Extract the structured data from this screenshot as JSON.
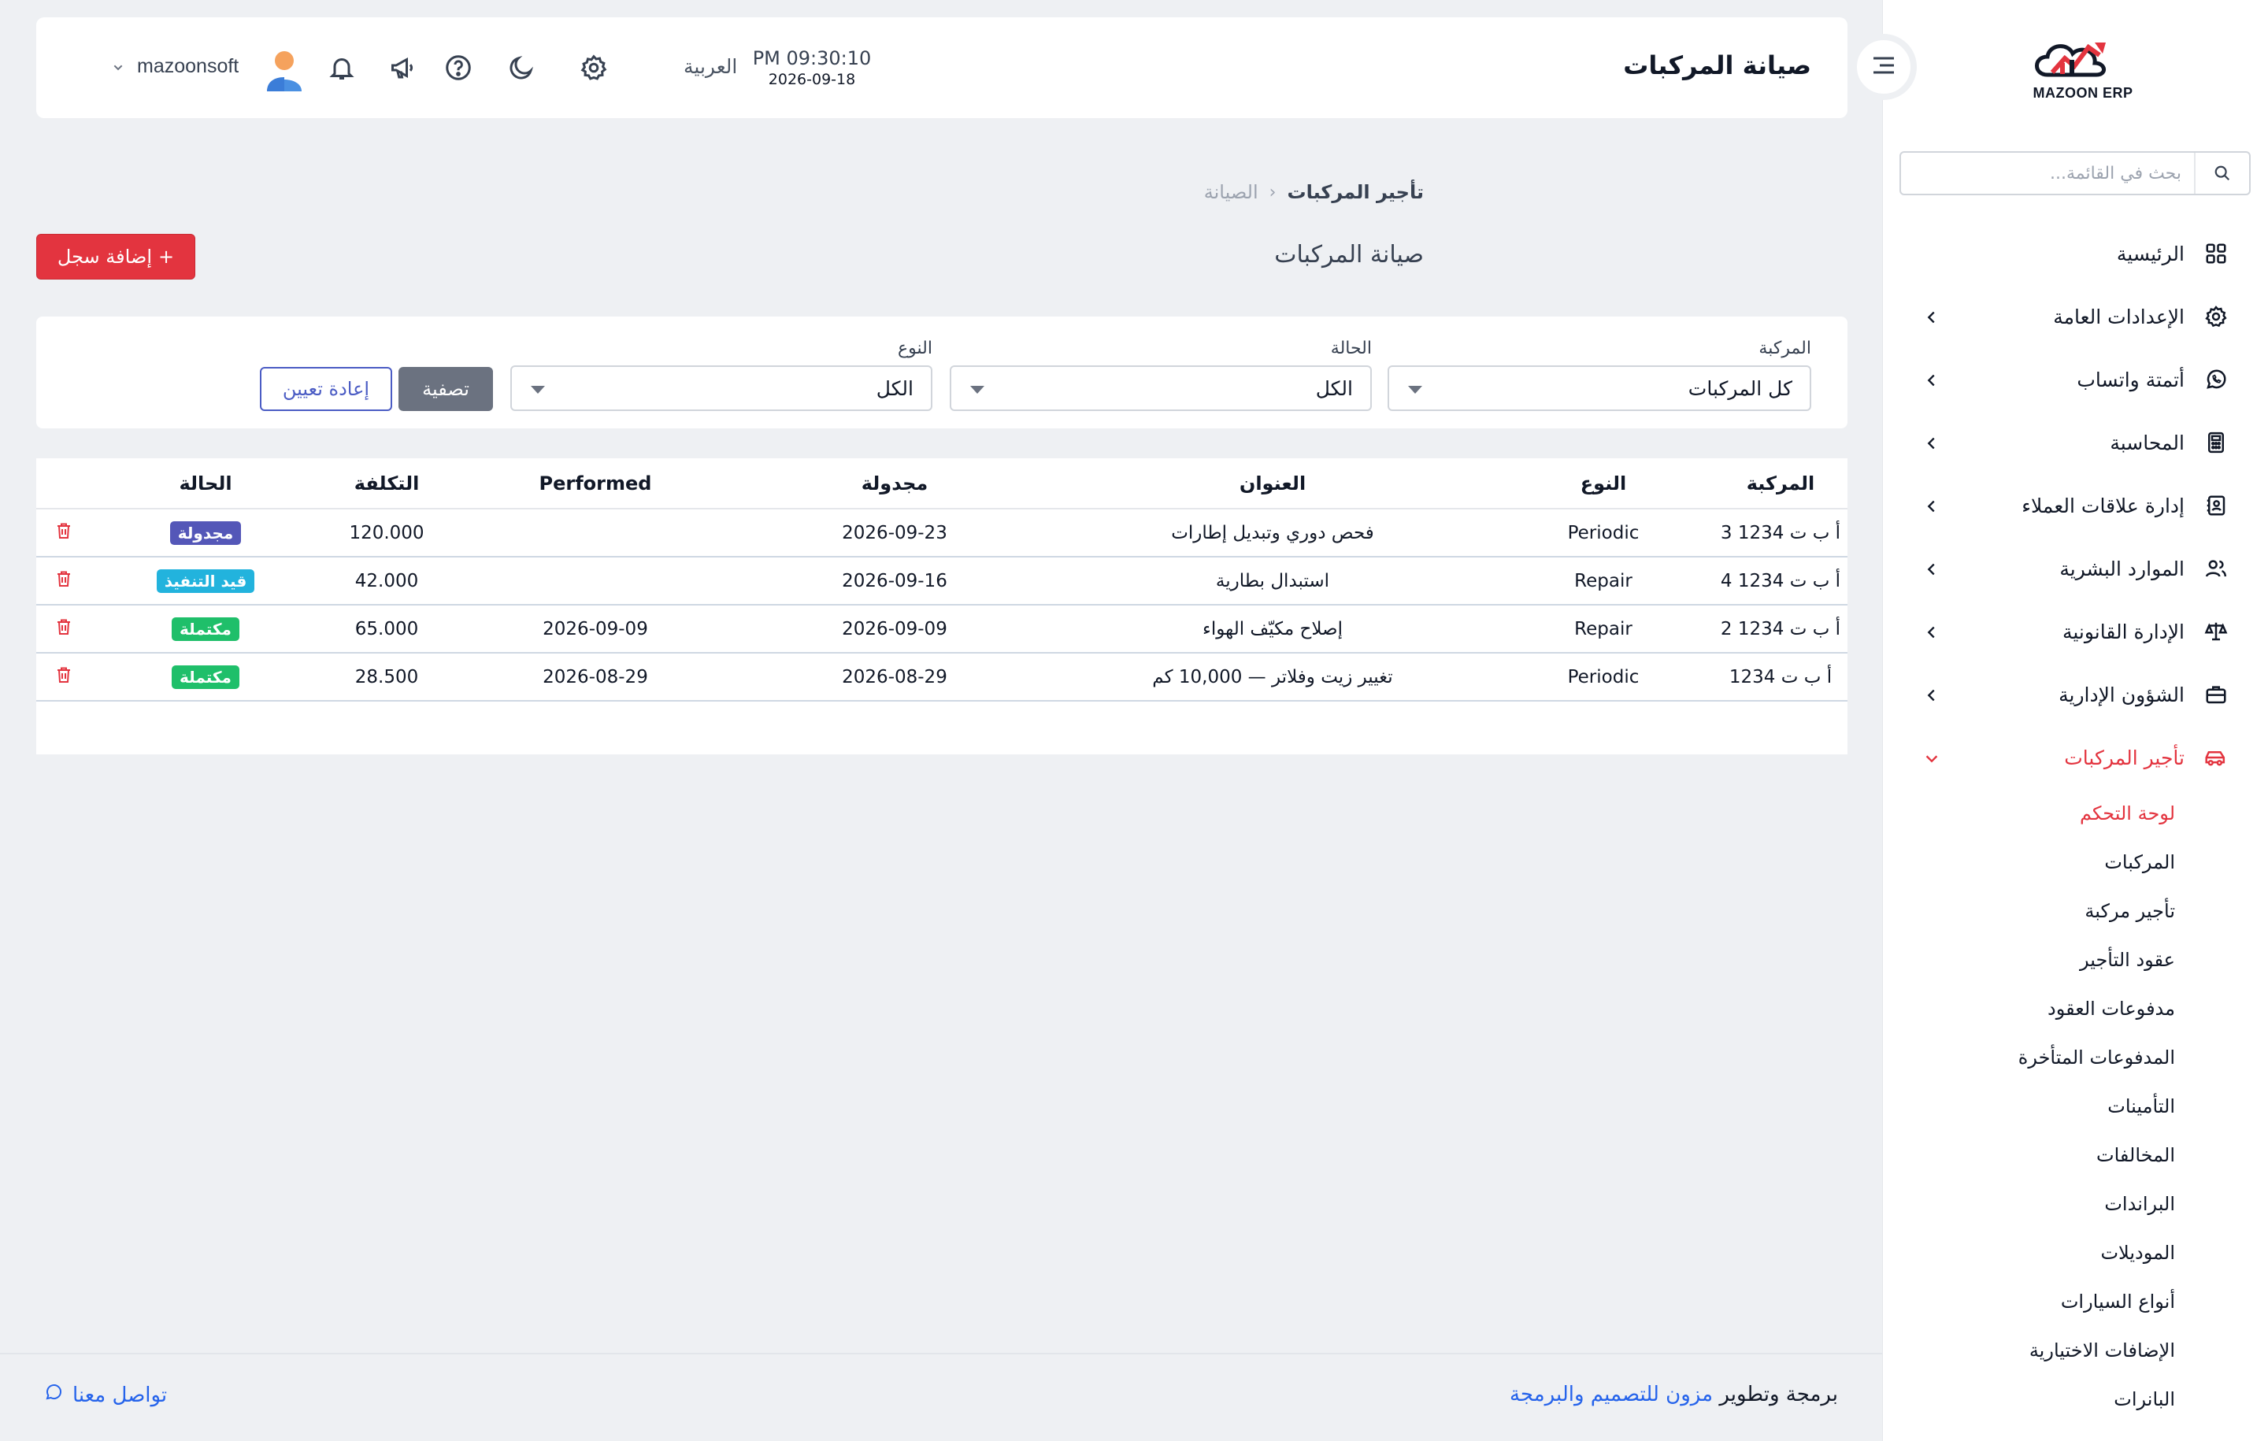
{
  "brand": {
    "logo_text": "MAZOON ERP"
  },
  "sidebar": {
    "search_placeholder": "بحث في القائمة...",
    "items": [
      {
        "label": "الرئيسية",
        "icon": "grid-icon"
      },
      {
        "label": "الإعدادات العامة",
        "icon": "gear-icon"
      },
      {
        "label": "أتمتة واتساب",
        "icon": "whatsapp-icon"
      },
      {
        "label": "المحاسبة",
        "icon": "calculator-icon"
      },
      {
        "label": "إدارة علاقات العملاء",
        "icon": "contacts-icon"
      },
      {
        "label": "الموارد البشرية",
        "icon": "users-icon"
      },
      {
        "label": "الإدارة القانونية",
        "icon": "scales-icon"
      },
      {
        "label": "الشؤون الإدارية",
        "icon": "briefcase-icon"
      },
      {
        "label": "تأجير المركبات",
        "icon": "car-icon"
      }
    ],
    "subitems": [
      "لوحة التحكم",
      "المركبات",
      "تأجير مركبة",
      "عقود التأجير",
      "مدفوعات العقود",
      "المدفوعات المتأخرة",
      "التأمينات",
      "المخالفات",
      "البراندات",
      "الموديلات",
      "أنواع السيارات",
      "الإضافات الاختيارية",
      "البانرات"
    ],
    "active_color": "#e3343f"
  },
  "header": {
    "title": "صيانة المركبات",
    "time": "PM 09:30:10",
    "date": "2026-09-18",
    "language": "العربية",
    "username": "mazoonsoft"
  },
  "breadcrumb": {
    "current": "تأجير المركبات",
    "parent": "الصيانة"
  },
  "page": {
    "title": "صيانة المركبات",
    "add_button": "إضافة سجل",
    "add_button_color": "#e3343f"
  },
  "filters": {
    "vehicle": {
      "label": "المركبة",
      "value": "كل المركبات"
    },
    "status": {
      "label": "الحالة",
      "value": "الكل"
    },
    "type": {
      "label": "النوع",
      "value": "الكل"
    },
    "filter_button": "تصفية",
    "reset_button": "إعادة تعيين"
  },
  "table": {
    "headers": [
      "المركبة",
      "النوع",
      "العنوان",
      "مجدولة",
      "Performed",
      "التكلفة",
      "الحالة"
    ],
    "rows": [
      {
        "vehicle": "أ ب ت 1234 3",
        "type": "Periodic",
        "title": "فحص دوري وتبديل إطارات",
        "scheduled": "2026-09-23",
        "performed": "",
        "cost": "120.000",
        "status": "مجدولة",
        "status_color": "#5457b8"
      },
      {
        "vehicle": "أ ب ت 1234 4",
        "type": "Repair",
        "title": "استبدال بطارية",
        "scheduled": "2026-09-16",
        "performed": "",
        "cost": "42.000",
        "status": "قيد التنفيذ",
        "status_color": "#22b3dd"
      },
      {
        "vehicle": "أ ب ت 1234 2",
        "type": "Repair",
        "title": "إصلاح مكيّف الهواء",
        "scheduled": "2026-09-09",
        "performed": "2026-09-09",
        "cost": "65.000",
        "status": "مكتملة",
        "status_color": "#1fbf6a"
      },
      {
        "vehicle": "أ ب ت 1234",
        "type": "Periodic",
        "title": "تغيير زيت وفلاتر — 10,000 كم",
        "scheduled": "2026-08-29",
        "performed": "2026-08-29",
        "cost": "28.500",
        "status": "مكتملة",
        "status_color": "#1fbf6a"
      }
    ]
  },
  "footer": {
    "contact": "تواصل معنا",
    "credit_prefix": "برمجة وتطوير",
    "credit_link": "مزون للتصميم والبرمجة"
  }
}
